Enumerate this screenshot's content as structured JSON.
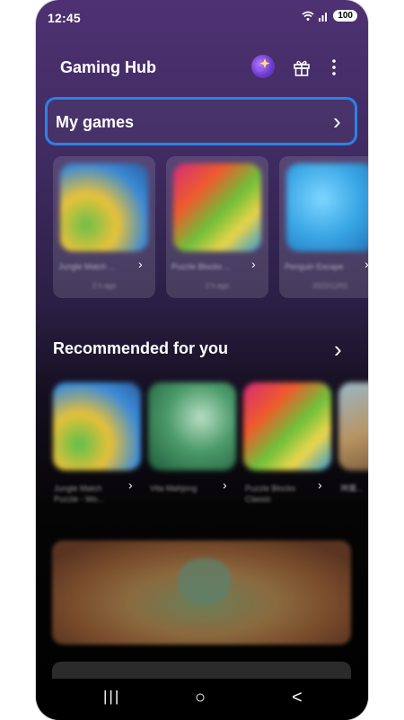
{
  "status_bar": {
    "time": "12:45",
    "battery": "100"
  },
  "app_bar": {
    "title": "Gaming Hub",
    "icons": [
      "profile-avatar",
      "gift-icon",
      "more-options-icon"
    ]
  },
  "my_games": {
    "title": "My games",
    "cards": [
      {
        "name": "Jungle Match ...",
        "sub": "3 h ago"
      },
      {
        "name": "Puzzle Blocks ...",
        "sub": "2 h ago"
      },
      {
        "name": "Penguin Escape",
        "sub": "2022/12/01"
      }
    ]
  },
  "recommended": {
    "title": "Recommended for you",
    "items": [
      {
        "name": "Jungle Match Puzzle - Wo..."
      },
      {
        "name": "Vita Mahjong"
      },
      {
        "name": "Puzzle Blocks Classic"
      },
      {
        "name": "神魔..."
      }
    ]
  },
  "nav_bar": {
    "recents": "|||",
    "home": "○",
    "back": "<"
  },
  "colors": {
    "accent": "#2b82e8",
    "header_purple": "#4e3172"
  }
}
